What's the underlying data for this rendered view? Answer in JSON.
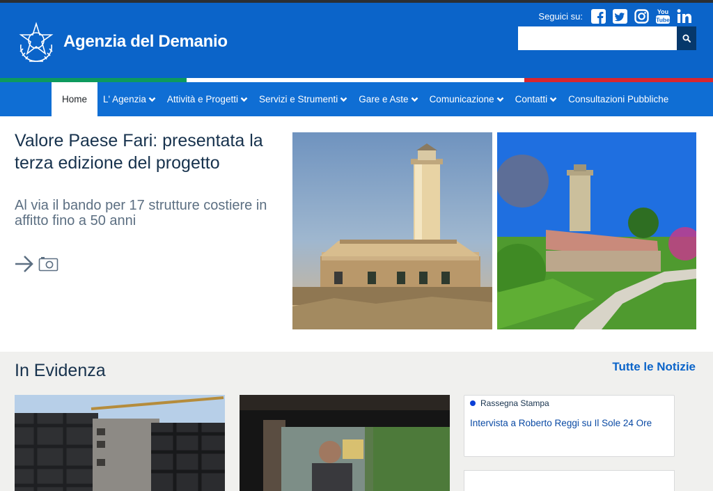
{
  "header": {
    "site_name": "Agenzia del Demanio",
    "social_label": "Seguici su:",
    "social_icons": [
      "facebook-icon",
      "twitter-icon",
      "instagram-icon",
      "youtube-icon",
      "linkedin-icon"
    ],
    "search_placeholder": ""
  },
  "nav": {
    "items": [
      {
        "label": "Home",
        "active": true,
        "dropdown": false
      },
      {
        "label": "L' Agenzia",
        "dropdown": true
      },
      {
        "label": "Attività e Progetti",
        "dropdown": true
      },
      {
        "label": "Servizi e Strumenti",
        "dropdown": true
      },
      {
        "label": "Gare e Aste",
        "dropdown": true
      },
      {
        "label": "Comunicazione",
        "dropdown": true
      },
      {
        "label": "Contatti",
        "dropdown": true
      },
      {
        "label": "Consultazioni Pubbliche",
        "dropdown": false
      }
    ]
  },
  "hero": {
    "title": "Valore Paese Fari: presentata la terza edizione del progetto",
    "subtitle": "Al via il bando per 17 strutture costiere in affitto fino a 50 anni"
  },
  "evidence": {
    "title": "In Evidenza",
    "all_news_link": "Tutte le Notizie",
    "news": [
      {
        "category": "Rassegna Stampa",
        "title": "Intervista a Roberto Reggi su Il Sole 24 Ore"
      }
    ]
  },
  "colors": {
    "header_blue": "#0b64c9",
    "nav_blue": "#0f6ed4",
    "title_navy": "#17324d",
    "tricolor_green": "#0d9a5e",
    "tricolor_red": "#d7262f"
  }
}
